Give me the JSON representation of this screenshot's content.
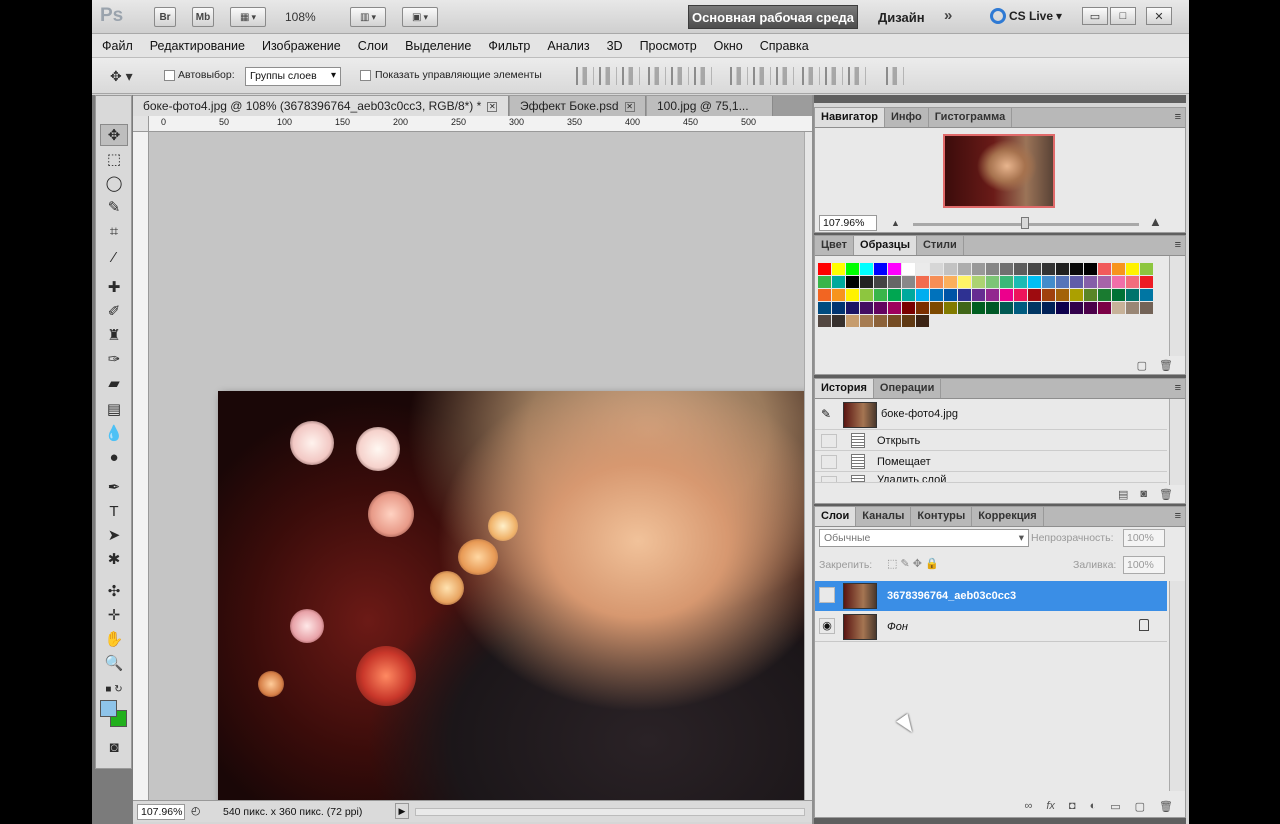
{
  "app": {
    "logo": "Ps",
    "top_buttons": [
      "Br",
      "Mb"
    ],
    "zoom": "108%",
    "workspace_button": "Основная рабочая среда",
    "design_label": "Дизайн",
    "more": "»",
    "cs_live": "CS Live",
    "window_controls": [
      "▭",
      "□",
      "✕"
    ]
  },
  "menu": [
    "Файл",
    "Редактирование",
    "Изображение",
    "Слои",
    "Выделение",
    "Фильтр",
    "Анализ",
    "3D",
    "Просмотр",
    "Окно",
    "Справка"
  ],
  "options": {
    "autoselect_label": "Автовыбор:",
    "autoselect_value": "Группы слоев",
    "show_controls_label": "Показать управляющие элементы"
  },
  "document": {
    "tabs": [
      {
        "label": "боке-фото4.jpg @ 108% (3678396764_aeb03c0cc3, RGB/8*) *",
        "active": true
      },
      {
        "label": "Эффект Боке.psd",
        "active": false
      },
      {
        "label": "100.jpg @ 75,1...",
        "active": false
      }
    ],
    "ruler_ticks": [
      "0",
      "50",
      "100",
      "150",
      "200",
      "250",
      "300",
      "350",
      "400",
      "450",
      "500"
    ],
    "status_zoom": "107.96%",
    "status_dims": "540 пикс. x 360 пикс. (72 ppi)"
  },
  "navigator": {
    "tabs": [
      "Навигатор",
      "Инфо",
      "Гистограмма"
    ],
    "zoom": "107.96%",
    "zoom_slider_fraction": 0.5
  },
  "swatches_panel": {
    "tabs": [
      "Цвет",
      "Образцы",
      "Стили"
    ]
  },
  "history": {
    "tabs": [
      "История",
      "Операции"
    ],
    "snapshot": "боке-фото4.jpg",
    "steps": [
      "Открыть",
      "Помещает",
      "Удалить слой"
    ]
  },
  "layers": {
    "tabs": [
      "Слои",
      "Каналы",
      "Контуры",
      "Коррекция"
    ],
    "blend_mode": "Обычные",
    "opacity_label": "Непрозрачность:",
    "opacity_value": "100%",
    "lock_label": "Закрепить:",
    "fill_label": "Заливка:",
    "fill_value": "100%",
    "items": [
      {
        "name": "3678396764_aeb03c0cc3",
        "selected": true,
        "visible": false
      },
      {
        "name": "Фон",
        "selected": false,
        "visible": true,
        "locked": true
      }
    ],
    "bottom_icons": [
      "link-icon",
      "fx-icon",
      "mask-icon",
      "adjustment-icon",
      "group-icon",
      "new-layer-icon",
      "trash-icon"
    ]
  },
  "colors": {
    "foreground": "#8ec4ea",
    "background": "#22b01d",
    "selection": "#3a8ee6"
  }
}
